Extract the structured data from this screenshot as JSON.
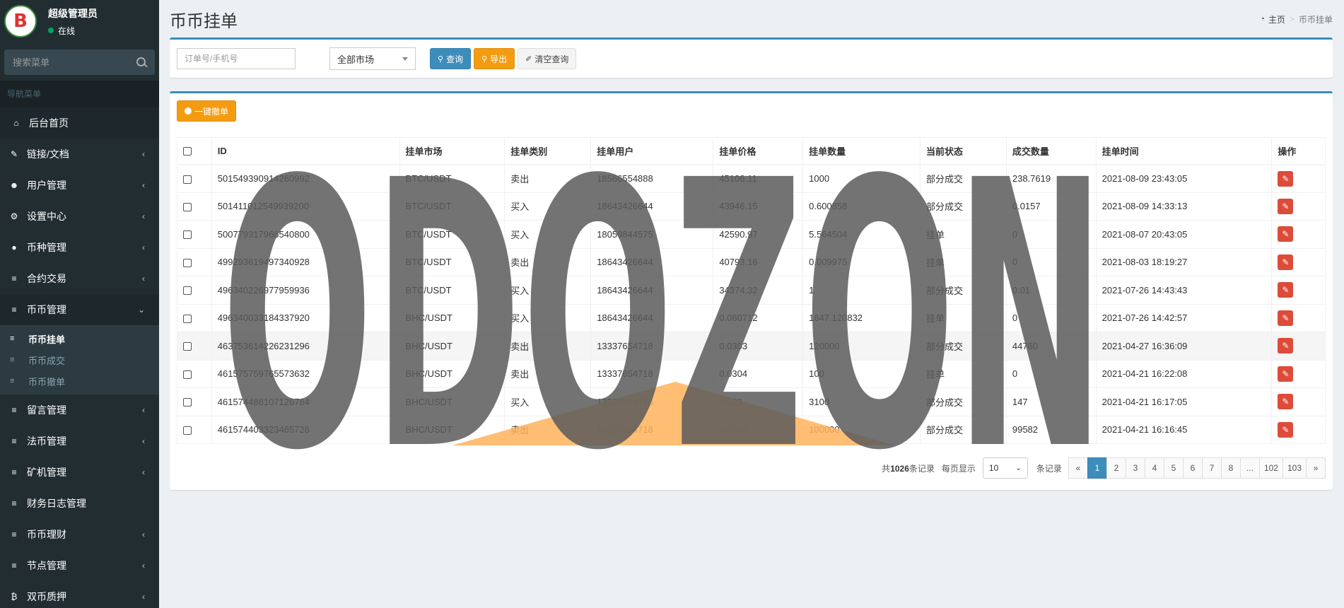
{
  "sidebar": {
    "user": {
      "avatar_letter": "B",
      "name": "超级管理员",
      "status": "在线"
    },
    "search_placeholder": "搜索菜单",
    "nav_header": "导航菜单",
    "items": [
      {
        "label": "后台首页",
        "icon": "home-icon",
        "glyph": "⌂",
        "has_children": false
      },
      {
        "label": "链接/文档",
        "icon": "pencil-icon",
        "glyph": "✎",
        "has_children": true
      },
      {
        "label": "用户管理",
        "icon": "users-icon",
        "glyph": "☻",
        "has_children": true
      },
      {
        "label": "设置中心",
        "icon": "gears-icon",
        "glyph": "⚙",
        "has_children": true
      },
      {
        "label": "币种管理",
        "icon": "circle-icon",
        "glyph": "●",
        "has_children": true
      },
      {
        "label": "合约交易",
        "icon": "list-icon",
        "glyph": "≡",
        "has_children": true
      },
      {
        "label": "币币管理",
        "icon": "list-icon",
        "glyph": "≡",
        "has_children": true,
        "open": true
      },
      {
        "label": "留言管理",
        "icon": "list-icon",
        "glyph": "≡",
        "has_children": true
      },
      {
        "label": "法币管理",
        "icon": "list-icon",
        "glyph": "≡",
        "has_children": true
      },
      {
        "label": "矿机管理",
        "icon": "list-icon",
        "glyph": "≡",
        "has_children": true
      },
      {
        "label": "财务日志管理",
        "icon": "list-icon",
        "glyph": "≡",
        "has_children": false
      },
      {
        "label": "币币理财",
        "icon": "list-icon",
        "glyph": "≡",
        "has_children": true
      },
      {
        "label": "节点管理",
        "icon": "list-icon",
        "glyph": "≡",
        "has_children": true
      },
      {
        "label": "双币质押",
        "icon": "bitcoin-icon",
        "glyph": "₿",
        "has_children": true
      }
    ],
    "submenu": [
      {
        "label": "币币挂单",
        "active": true
      },
      {
        "label": "币币成交",
        "active": false
      },
      {
        "label": "币币撤单",
        "active": false
      }
    ]
  },
  "header": {
    "title": "币币挂单",
    "breadcrumb": {
      "home": "主页",
      "current": "币币挂单"
    }
  },
  "filter": {
    "order_placeholder": "订单号/手机号",
    "market_select": "全部市场",
    "query": "查询",
    "export": "导出",
    "clear": "清空查询"
  },
  "toolbar": {
    "bulk_cancel": "一键撤单"
  },
  "table": {
    "columns": [
      "ID",
      "挂单市场",
      "挂单类别",
      "挂单用户",
      "挂单价格",
      "挂单数量",
      "当前状态",
      "成交数量",
      "挂单时间",
      "操作"
    ],
    "rows": [
      [
        "501549390914260992",
        "BTC/USDT",
        "卖出",
        "18566554888",
        "45106.11",
        "1000",
        "部分成交",
        "238.7619",
        "2021-08-09 23:43:05"
      ],
      [
        "501411012549939200",
        "BTC/USDT",
        "买入",
        "18643426644",
        "43946.15",
        "0.600858",
        "部分成交",
        "0.0157",
        "2021-08-09 14:33:13"
      ],
      [
        "500779317966540800",
        "BTC/USDT",
        "买入",
        "18059844575",
        "42590.97",
        "5.564504",
        "挂单",
        "0",
        "2021-08-07 20:43:05"
      ],
      [
        "499293619497340928",
        "BTC/USDT",
        "卖出",
        "18643426644",
        "40793.16",
        "0.009975",
        "挂单",
        "0",
        "2021-08-03 18:19:27"
      ],
      [
        "496340226977959936",
        "BTC/USDT",
        "买入",
        "18643426644",
        "34374.32",
        "1",
        "部分成交",
        "0.01",
        "2021-07-26 14:43:43"
      ],
      [
        "496340033184337920",
        "BHC/USDT",
        "买入",
        "18643426644",
        "0.060712",
        "1647.120832",
        "挂单",
        "0",
        "2021-07-26 14:42:57"
      ],
      [
        "463753614226231296",
        "BHC/USDT",
        "卖出",
        "13337654718",
        "0.0303",
        "120000",
        "部分成交",
        "44760",
        "2021-04-27 16:36:09"
      ],
      [
        "461575759765573632",
        "BHC/USDT",
        "卖出",
        "13337654718",
        "0.0304",
        "100",
        "挂单",
        "0",
        "2021-04-21 16:22:08"
      ],
      [
        "461574488107126784",
        "BHC/USDT",
        "买入",
        "13337654718",
        "0.029",
        "3100",
        "部分成交",
        "147",
        "2021-04-21 16:17:05"
      ],
      [
        "461574403323465728",
        "BHC/USDT",
        "卖出",
        "13337654718",
        "0.0304",
        "100000",
        "部分成交",
        "99582",
        "2021-04-21 16:16:45"
      ]
    ]
  },
  "pager": {
    "total_prefix": "共",
    "total": "1026",
    "total_suffix": "条记录",
    "per_page_label": "每页显示",
    "per_page": "10",
    "per_page_suffix": "条记录",
    "pages": [
      "«",
      "1",
      "2",
      "3",
      "4",
      "5",
      "6",
      "7",
      "8",
      "...",
      "102",
      "103",
      "»"
    ],
    "active_page": "1"
  },
  "watermark": {
    "text": "ODOZON",
    "color": "#5a5a5a",
    "accent": "#ffb35c"
  },
  "colors": {
    "primary": "#3c8dbc",
    "warning": "#f39c12",
    "danger": "#dd4b39",
    "sidebar": "#222d32"
  }
}
